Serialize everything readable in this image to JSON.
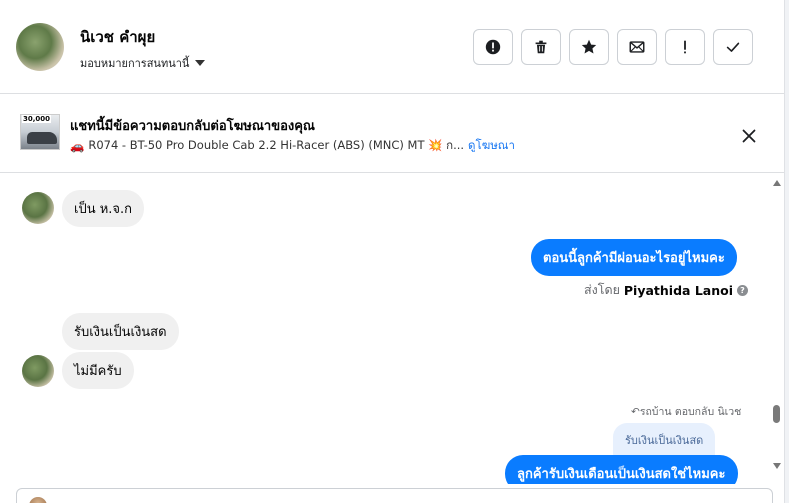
{
  "header": {
    "contact_name": "นิเวช คำผุย",
    "assign_label": "มอบหมายการสนทนานี้",
    "actions": [
      {
        "name": "report-button",
        "icon": "alert-circle-icon"
      },
      {
        "name": "delete-button",
        "icon": "trash-icon"
      },
      {
        "name": "star-button",
        "icon": "star-icon"
      },
      {
        "name": "mark-unread-button",
        "icon": "envelope-icon"
      },
      {
        "name": "follow-up-button",
        "icon": "exclamation-icon"
      },
      {
        "name": "mark-done-button",
        "icon": "checkmark-icon"
      }
    ]
  },
  "ad_context": {
    "title": "แชทนี้มีข้อความตอบกลับต่อโฆษณาของคุณ",
    "ad_text": "R074 - BT-50 Pro Double Cab 2.2 Hi-Racer (ABS) (MNC) MT 💥 ก...",
    "view_ad_link": "ดูโฆษณา",
    "thumbnail_price": "30,000",
    "car_emoji": "🚗"
  },
  "messages": {
    "m1": "เป็น ห.จ.ก",
    "m2": "ตอนนี้ลูกค้ามีผ่อนอะไรอยู่ไหมคะ",
    "sent_by_prefix": "ส่งโดย",
    "sent_by_name": "Piyathida Lanoi",
    "m3": "รับเงินเป็นเงินสด",
    "m4": "ไม่มีครับ",
    "reply_note": "รถบ้าน ตอบกลับ นิเวช",
    "quoted_text": "รับเงินเป็นเงินสด",
    "m5": "ลูกค้ารับเงินเดือนเป็นเงินสดใช่ไหมคะ"
  },
  "colors": {
    "accent_blue": "#0a7cff",
    "incoming_bubble": "#f0f0f0",
    "link": "#1877f2"
  }
}
